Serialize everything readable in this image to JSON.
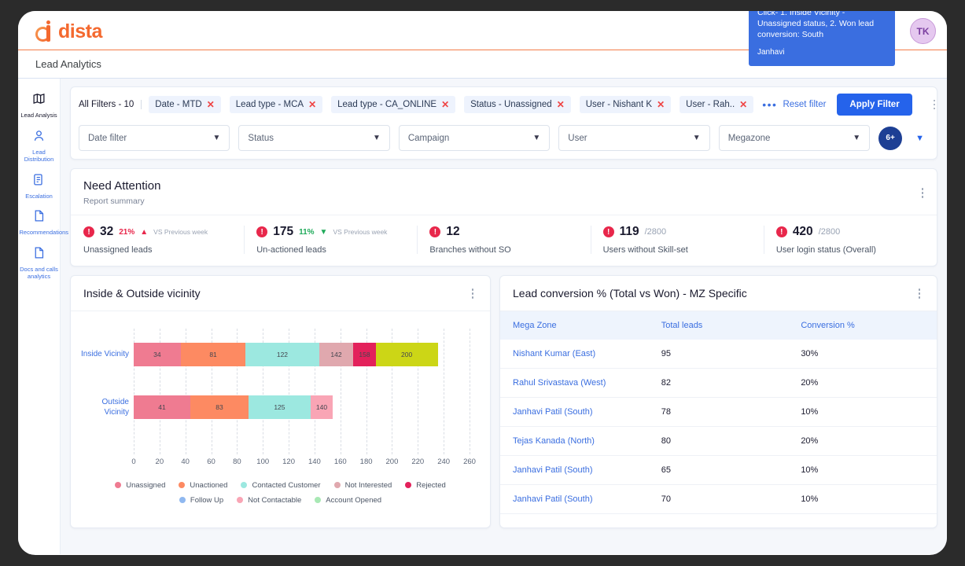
{
  "brand": {
    "name": "dista",
    "logo_icon": "dista-logo-icon"
  },
  "callout": {
    "text": "Click- 1. Inside Vicinity - Unassigned status, 2. Won lead conversion: South",
    "sub": "Janhavi",
    "color": "#3a6ee0"
  },
  "avatar": {
    "initials": "TK"
  },
  "page": {
    "title": "Lead Analytics"
  },
  "sidebar": {
    "items": [
      {
        "label": "Lead Analysis",
        "icon": "map-icon",
        "active": true
      },
      {
        "label": "Lead Distribution",
        "icon": "person-icon",
        "active": false
      },
      {
        "label": "Escalation",
        "icon": "document-list-icon",
        "active": false
      },
      {
        "label": "Recommendations",
        "icon": "file-icon",
        "active": false
      },
      {
        "label": "Docs and calls analytics",
        "icon": "file-icon",
        "active": false
      }
    ]
  },
  "filters": {
    "all_filters_label": "All Filters - 10",
    "chips": [
      {
        "label": "Date - MTD"
      },
      {
        "label": "Lead type - MCA"
      },
      {
        "label": "Lead type - CA_ONLINE"
      },
      {
        "label": "Status - Unassigned"
      },
      {
        "label": "User  - Nishant K"
      },
      {
        "label": "User  - Rah.."
      }
    ],
    "more_icon": "ellipsis-icon",
    "reset_label": "Reset filter",
    "apply_label": "Apply Filter",
    "kebab_icon": "kebab-menu-icon",
    "selects": [
      {
        "label": "Date filter"
      },
      {
        "label": "Status"
      },
      {
        "label": "Campaign"
      },
      {
        "label": "User"
      },
      {
        "label": "Megazone"
      }
    ],
    "count_badge": "6+",
    "expand_icon": "chevron-down-icon"
  },
  "need_attention": {
    "title": "Need Attention",
    "subtitle": "Report summary",
    "kebab_icon": "kebab-menu-icon",
    "metrics": [
      {
        "value": "32",
        "denom": "",
        "delta": "21%",
        "delta_dir": "up",
        "vs": "VS Previous week",
        "label": "Unassigned leads"
      },
      {
        "value": "175",
        "denom": "",
        "delta": "11%",
        "delta_dir": "down",
        "vs": "VS Previous week",
        "label": "Un-actioned leads"
      },
      {
        "value": "12",
        "denom": "",
        "delta": "",
        "delta_dir": "",
        "vs": "",
        "label": "Branches without SO"
      },
      {
        "value": "119",
        "denom": "/2800",
        "delta": "",
        "delta_dir": "",
        "vs": "",
        "label": "Users without Skill-set"
      },
      {
        "value": "420",
        "denom": "/2800",
        "delta": "",
        "delta_dir": "",
        "vs": "",
        "label": "User login status (Overall)"
      }
    ]
  },
  "vicinity_panel": {
    "title": "Inside & Outside vicinity",
    "kebab_icon": "kebab-menu-icon"
  },
  "chart_data": {
    "type": "bar",
    "orientation": "horizontal",
    "stacked": true,
    "title": "Inside & Outside vicinity",
    "xlabel": "",
    "ylabel": "",
    "xlim": [
      0,
      260
    ],
    "xticks": [
      0,
      20,
      40,
      60,
      80,
      100,
      120,
      140,
      160,
      180,
      200,
      220,
      240,
      260
    ],
    "grid": true,
    "legend_position": "bottom",
    "categories": [
      "Inside Vicinity",
      "Outside Vicinity"
    ],
    "series": [
      {
        "name": "Unassigned",
        "color": "#ef7b91",
        "values": [
          34,
          41
        ]
      },
      {
        "name": "Unactioned",
        "color": "#fd8a62",
        "values": [
          81,
          83
        ]
      },
      {
        "name": "Contacted Customer",
        "color": "#9ce8e0",
        "values": [
          122,
          125
        ]
      },
      {
        "name": "Not Interested",
        "color": "#e0a8ae",
        "values": [
          142,
          140
        ]
      },
      {
        "name": "Rejected",
        "color": "#e3215b",
        "values": [
          158,
          0
        ]
      },
      {
        "name": "Follow Up",
        "color": "#8fb8f0",
        "values": [
          0,
          0
        ]
      },
      {
        "name": "Not Contactable",
        "color": "#f9a5b5",
        "values": [
          0,
          0
        ]
      },
      {
        "name": "Account Opened",
        "color": "#a8e8b4",
        "values": [
          200,
          0
        ]
      }
    ],
    "bar_segments": [
      {
        "category": "Inside Vicinity",
        "segments": [
          {
            "label": "34",
            "width": 34,
            "color": "#ef7b91"
          },
          {
            "label": "81",
            "width": 47,
            "color": "#fd8a62"
          },
          {
            "label": "122",
            "width": 53,
            "color": "#9ce8e0"
          },
          {
            "label": "142",
            "width": 25,
            "color": "#e0a8ae"
          },
          {
            "label": "158",
            "width": 16,
            "color": "#e3215b"
          },
          {
            "label": "200",
            "width": 45,
            "color": "#ccd616"
          }
        ]
      },
      {
        "category": "Outside Vicinity",
        "segments": [
          {
            "label": "41",
            "width": 41,
            "color": "#ef7b91"
          },
          {
            "label": "83",
            "width": 42,
            "color": "#fd8a62"
          },
          {
            "label": "125",
            "width": 45,
            "color": "#9ce8e0"
          },
          {
            "label": "140",
            "width": 16,
            "color": "#f9a5b5"
          }
        ]
      }
    ],
    "legend": [
      {
        "name": "Unassigned",
        "color": "#ef7b91"
      },
      {
        "name": "Unactioned",
        "color": "#fd8a62"
      },
      {
        "name": "Contacted Customer",
        "color": "#9ce8e0"
      },
      {
        "name": "Not Interested",
        "color": "#e0a8ae"
      },
      {
        "name": "Rejected",
        "color": "#e3215b"
      },
      {
        "name": "Follow Up",
        "color": "#8fb8f0"
      },
      {
        "name": "Not Contactable",
        "color": "#f9a5b5"
      },
      {
        "name": "Account Opened",
        "color": "#a8e8b4"
      }
    ]
  },
  "conversion_panel": {
    "title": "Lead conversion % (Total vs Won) - MZ Specific",
    "kebab_icon": "kebab-menu-icon",
    "columns": [
      "Mega Zone",
      "Total leads",
      "Conversion %"
    ],
    "rows": [
      {
        "zone": "Nishant Kumar (East)",
        "total": "95",
        "conversion": "30%"
      },
      {
        "zone": "Rahul Srivastava (West)",
        "total": "82",
        "conversion": "20%"
      },
      {
        "zone": "Janhavi Patil (South)",
        "total": "78",
        "conversion": "10%"
      },
      {
        "zone": "Tejas Kanada (North)",
        "total": "80",
        "conversion": "20%"
      },
      {
        "zone": "Janhavi Patil (South)",
        "total": "65",
        "conversion": "10%"
      },
      {
        "zone": "Janhavi Patil (South)",
        "total": "70",
        "conversion": "10%"
      }
    ]
  }
}
